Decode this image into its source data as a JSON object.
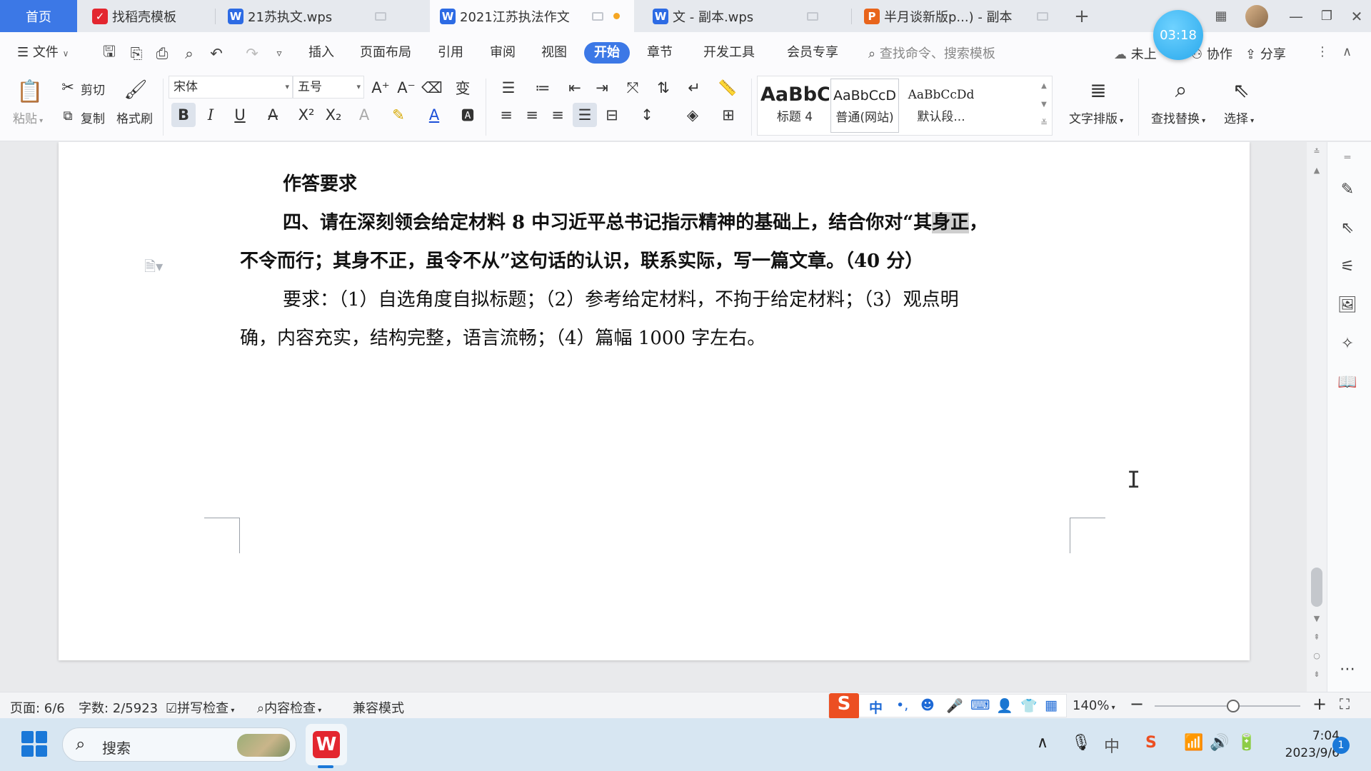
{
  "tabs": {
    "home": "首页",
    "template": "找稻壳模板",
    "doc1": "21苏执文.wps",
    "doc2": "2021江苏执法作文",
    "doc3": "文 - 副本.wps",
    "doc4": "半月谈新版p...) - 副本",
    "new_tab": "+"
  },
  "timer": "03:18",
  "menu": {
    "file": "文件",
    "insert": "插入",
    "page_layout": "页面布局",
    "references": "引用",
    "review": "审阅",
    "view": "视图",
    "start": "开始",
    "chapter": "章节",
    "developer": "开发工具",
    "member": "会员专享",
    "search_placeholder": "查找命令、搜索模板",
    "cloud": "未上",
    "collab": "协作",
    "share": "分享"
  },
  "ribbon": {
    "paste": "粘贴",
    "cut": "剪切",
    "copy": "复制",
    "format_painter": "格式刷",
    "font_name": "宋体",
    "font_size": "五号",
    "styles": [
      {
        "preview": "AaBbC",
        "name": "标题 4"
      },
      {
        "preview": "AaBbCcD",
        "name": "普通(网站)"
      },
      {
        "preview": "AaBbCcDd",
        "name": "默认段..."
      }
    ],
    "text_layout": "文字排版",
    "find_replace": "查找替换",
    "select": "选择"
  },
  "document": {
    "heading": "作答要求",
    "q_line1_pre": "四、请在深刻领会给定材料 8 中习近平总书记指示精神的基础上，结合你对“其",
    "q_line1_sel": "身正",
    "q_line1_post": "，",
    "q_line2": "不令而行；其身不正，虽令不从”这句话的认识，联系实际，写一篇文章。（40 分）",
    "req_line1": "要求：（1）自选角度自拟标题；（2）参考给定材料，不拘于给定材料；（3）观点明",
    "req_line2": "确，内容充实，结构完整，语言流畅；（4）篇幅 1000 字左右。"
  },
  "status": {
    "page": "页面: 6/6",
    "words": "字数: 2/5923",
    "spell": "拼写检查",
    "content_check": "内容检查",
    "compat": "兼容模式",
    "zoom": "140%"
  },
  "ime": {
    "lang": "中",
    "punct": "•,"
  },
  "taskbar": {
    "search": "搜索",
    "lang": "中",
    "time": "7:04",
    "date": "2023/9/6",
    "notifications": "1"
  }
}
